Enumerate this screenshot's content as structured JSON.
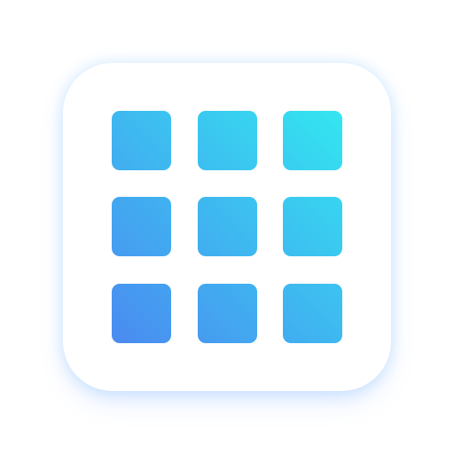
{
  "icon": {
    "name": "app-grid-icon",
    "grid": {
      "rows": 3,
      "columns": 3
    },
    "gradient": {
      "start": "#4A8AF0",
      "end": "#33E6F0"
    },
    "card_color": "#FFFFFF",
    "glow_color": "#8CC8FF"
  }
}
